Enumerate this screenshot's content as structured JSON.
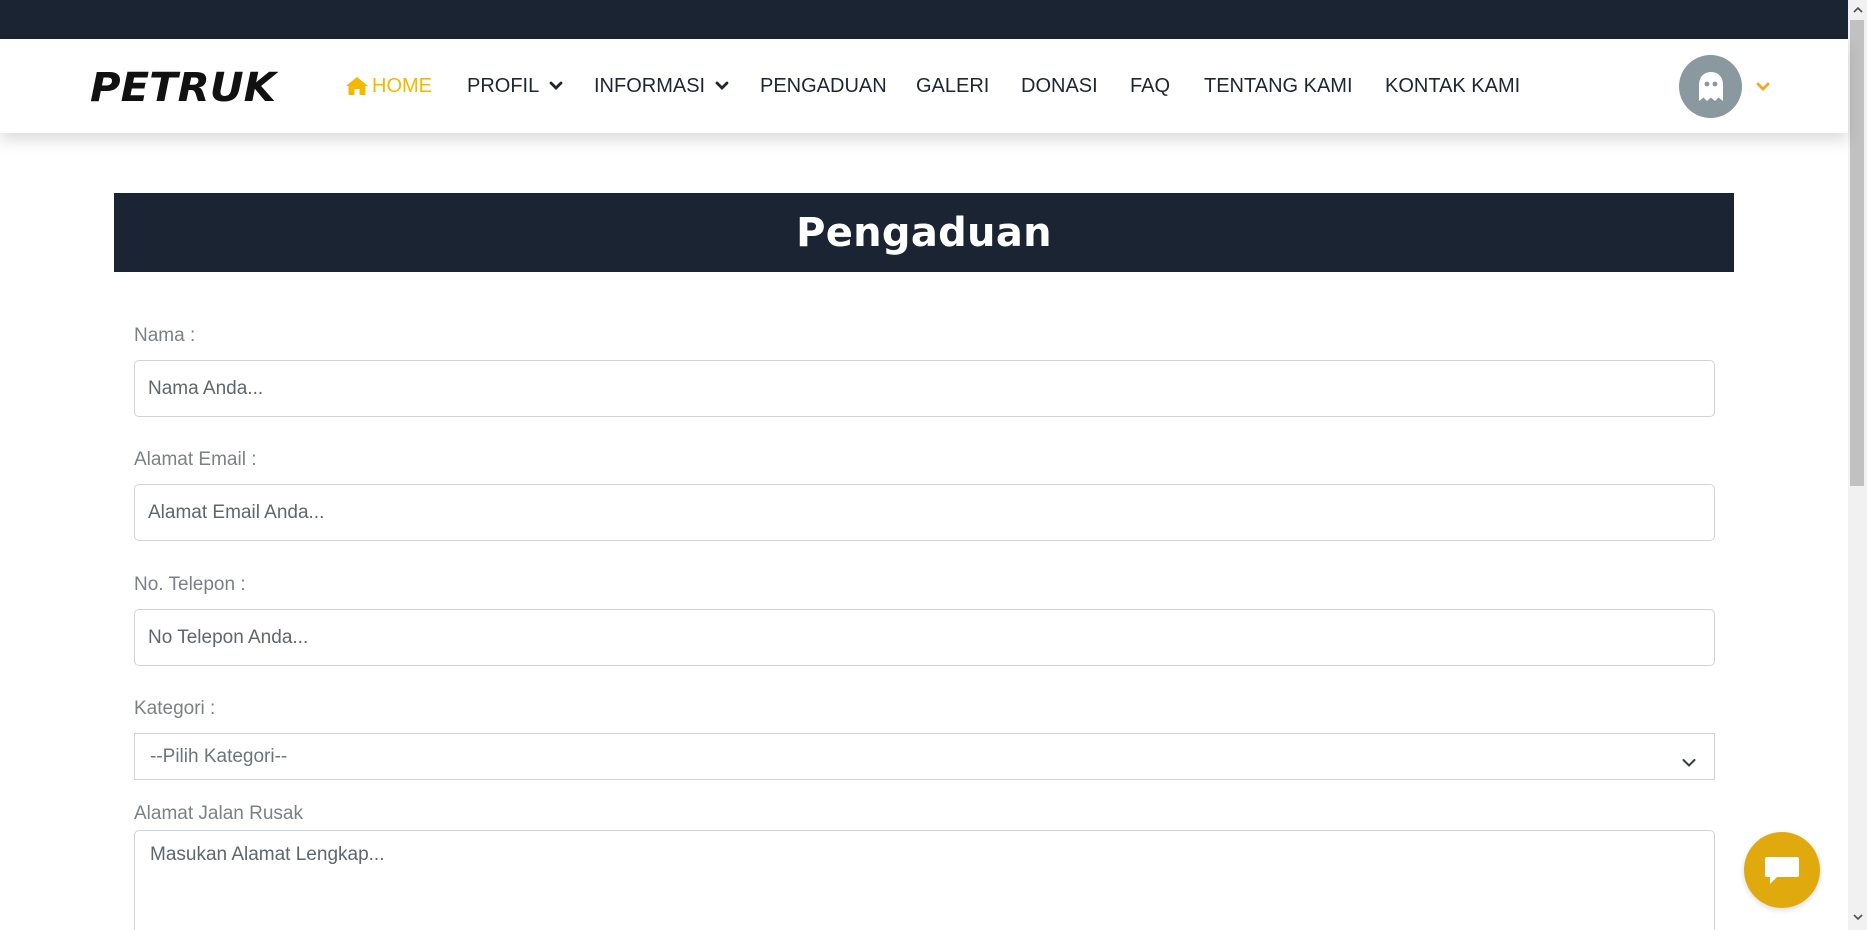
{
  "brand": {
    "logo_text": "PETRUK"
  },
  "colors": {
    "dark": "#1b2432",
    "accent": "#f5b800",
    "chat": "#e0aa0f",
    "avatar": "#8a989f"
  },
  "nav": {
    "items": [
      {
        "label": "HOME",
        "icon": "home-icon",
        "active": true
      },
      {
        "label": "PROFIL",
        "dropdown": true
      },
      {
        "label": "INFORMASI",
        "dropdown": true
      },
      {
        "label": "PENGADUAN"
      },
      {
        "label": "GALERI"
      },
      {
        "label": "DONASI"
      },
      {
        "label": "FAQ"
      },
      {
        "label": "TENTANG KAMI"
      },
      {
        "label": "KONTAK KAMI"
      }
    ],
    "user_icon": "ghost-icon"
  },
  "page": {
    "title": "Pengaduan"
  },
  "form": {
    "nama": {
      "label": "Nama :",
      "placeholder": "Nama Anda..."
    },
    "email": {
      "label": "Alamat Email :",
      "placeholder": "Alamat Email Anda..."
    },
    "telepon": {
      "label": "No. Telepon :",
      "placeholder": "No Telepon Anda..."
    },
    "kategori": {
      "label": "Kategori :",
      "selected": "--Pilih Kategori--"
    },
    "alamat": {
      "label": "Alamat Jalan Rusak",
      "placeholder": "Masukan Alamat Lengkap..."
    }
  },
  "chat": {
    "icon": "chat-bubble-icon"
  }
}
